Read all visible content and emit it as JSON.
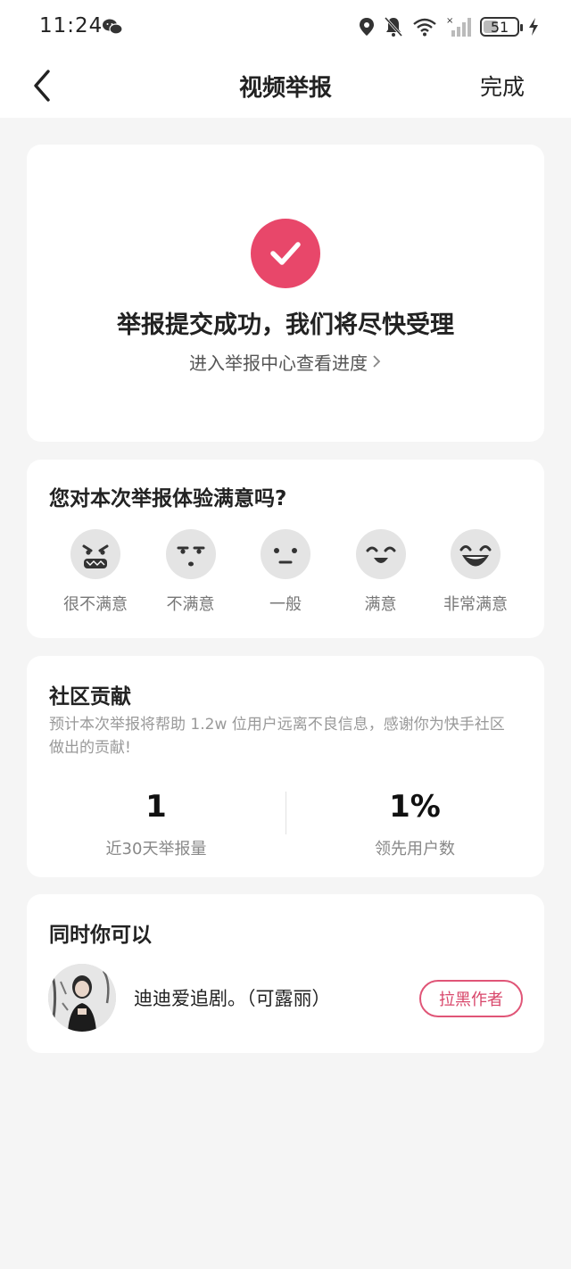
{
  "status_bar": {
    "time": "11:24",
    "battery": "51",
    "battery_level": 0.51,
    "icons": [
      "wechat-icon",
      "location-icon",
      "bell-off-icon",
      "wifi-icon",
      "signal-icon",
      "charging-icon"
    ]
  },
  "nav": {
    "title": "视频举报",
    "done_label": "完成"
  },
  "success": {
    "title": "举报提交成功，我们将尽快受理",
    "link": "进入举报中心查看进度",
    "accent": "#e8476a"
  },
  "satisfaction": {
    "question": "您对本次举报体验满意吗?",
    "options": [
      {
        "label": "很不满意",
        "icon": "very-dissatisfied-face-icon"
      },
      {
        "label": "不满意",
        "icon": "dissatisfied-face-icon"
      },
      {
        "label": "一般",
        "icon": "neutral-face-icon"
      },
      {
        "label": "满意",
        "icon": "satisfied-face-icon"
      },
      {
        "label": "非常满意",
        "icon": "very-satisfied-face-icon"
      }
    ]
  },
  "contribution": {
    "title": "社区贡献",
    "description": "预计本次举报将帮助 1.2w 位用户远离不良信息，感谢你为快手社区做出的贡献!",
    "stats": [
      {
        "value": "1",
        "label": "近30天举报量"
      },
      {
        "value": "1%",
        "label": "领先用户数"
      }
    ]
  },
  "also": {
    "title": "同时你可以",
    "author_name": "迪迪爱追剧。（可露丽）",
    "block_label": "拉黑作者",
    "block_color": "#d8466a"
  }
}
